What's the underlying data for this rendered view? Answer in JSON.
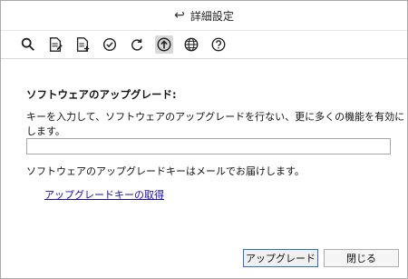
{
  "window": {
    "title": "詳細設定",
    "back_glyph": "↩"
  },
  "toolbar": {
    "icons": [
      "search-icon",
      "edit-document-icon",
      "add-document-icon",
      "check-circle-icon",
      "refresh-icon",
      "upgrade-icon",
      "globe-icon",
      "help-icon"
    ],
    "active": "upgrade-icon"
  },
  "main": {
    "section_title": "ソフトウェアのアップグレード:",
    "description": "キーを入力して、ソフトウェアのアップグレードを行ない、更に多くの機能を有効にします。",
    "key_input": {
      "value": "",
      "placeholder": ""
    },
    "info_text": "ソフトウェアのアップグレードキーはメールでお届けします。",
    "link_text": "アップグレードキーの取得"
  },
  "buttons": {
    "upgrade": "アップグレード",
    "close": "閉じる"
  },
  "colors": {
    "link": "#1a0dab",
    "active_tool_bg": "#d8d8d8",
    "primary_border": "#2b6fd6"
  }
}
